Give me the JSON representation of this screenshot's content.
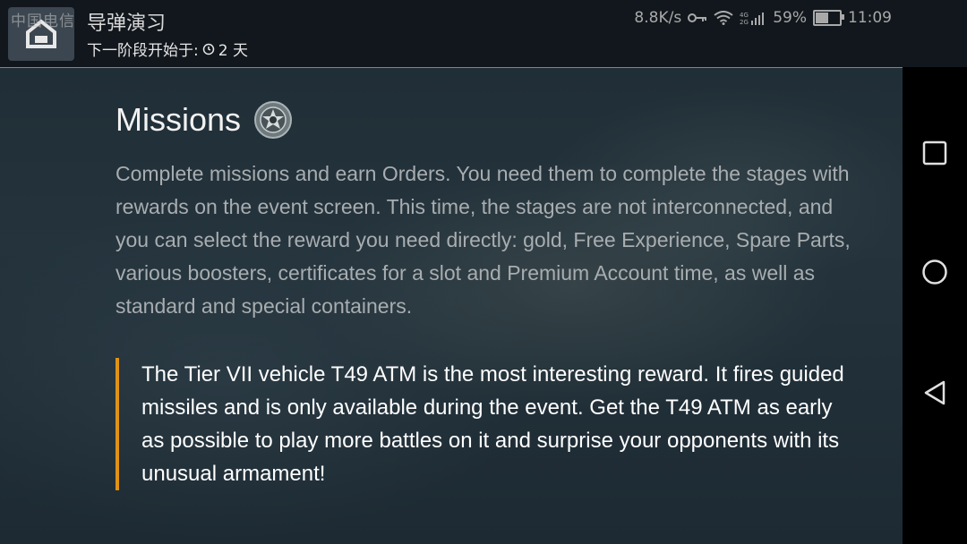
{
  "status_bar": {
    "carrier": "中国电信",
    "net_speed": "8.8K/s",
    "network": "4G 2G",
    "battery_percent": "59%",
    "battery_level": 0.59,
    "time": "11:09"
  },
  "header": {
    "title": "导弹演习",
    "subtitle_prefix": "下一阶段开始于:",
    "countdown": "2 天"
  },
  "main": {
    "heading": "Missions",
    "heading_icon": "order-medal-icon",
    "intro": "Complete missions and earn Orders. You need them to complete the stages with rewards on the event screen. This time, the stages are not interconnected, and you can select the reward you need directly: gold, Free Experience, Spare Parts, various boosters, certificates for a slot and Premium Account time, as well as standard and special containers.",
    "highlight": "The Tier VII vehicle T49 ATM is the most interesting reward. It fires guided missiles and is only available during the event. Get the T49 ATM as early as possible to play more battles on it and surprise your opponents with its unusual armament!"
  },
  "nav": {
    "recents": "square-recents-icon",
    "home": "circle-home-icon",
    "back": "triangle-back-icon"
  },
  "colors": {
    "accent": "#e09216",
    "text_muted": "#a8adb0",
    "text_bright": "#ffffff"
  }
}
